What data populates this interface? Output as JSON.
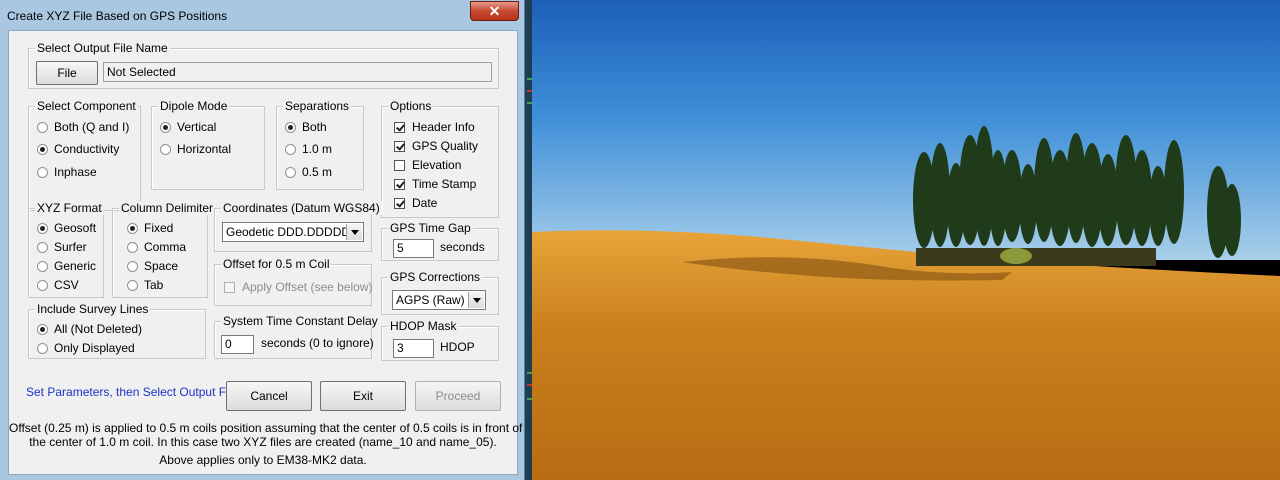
{
  "window": {
    "title": "Create XYZ File Based on GPS Positions",
    "close_glyph": "✕"
  },
  "output_file": {
    "group_label": "Select Output File Name",
    "button_label": "File",
    "path_value": "Not Selected"
  },
  "component": {
    "label": "Select Component",
    "options": [
      "Both (Q and I)",
      "Conductivity",
      "Inphase"
    ],
    "selected": "Conductivity"
  },
  "dipole": {
    "label": "Dipole Mode",
    "options": [
      "Vertical",
      "Horizontal"
    ],
    "selected": "Vertical"
  },
  "separations": {
    "label": "Separations",
    "options": [
      "Both",
      "1.0 m",
      "0.5 m"
    ],
    "selected": "Both"
  },
  "options": {
    "label": "Options",
    "items": [
      {
        "label": "Header Info",
        "checked": true
      },
      {
        "label": "GPS Quality",
        "checked": true
      },
      {
        "label": "Elevation",
        "checked": false
      },
      {
        "label": "Time Stamp",
        "checked": true
      },
      {
        "label": "Date",
        "checked": true
      }
    ]
  },
  "xyz_format": {
    "label": "XYZ Format",
    "options": [
      "Geosoft",
      "Surfer",
      "Generic",
      "CSV"
    ],
    "selected": "Geosoft"
  },
  "column_delimiter": {
    "label": "Column Delimiter",
    "options": [
      "Fixed",
      "Comma",
      "Space",
      "Tab"
    ],
    "selected": "Fixed"
  },
  "coordinates": {
    "label": "Coordinates (Datum WGS84)",
    "value": "Geodetic DDD.DDDDD"
  },
  "offset": {
    "label": "Offset for 0.5 m Coil",
    "checkbox_label": "Apply Offset (see below)",
    "checked": false
  },
  "time_constant": {
    "label": "System Time Constant Delay",
    "value": "0",
    "suffix": "seconds (0 to ignore)"
  },
  "gps_time_gap": {
    "label": "GPS Time Gap",
    "value": "5",
    "suffix": "seconds"
  },
  "gps_corrections": {
    "label": "GPS Corrections",
    "value": "AGPS (Raw)"
  },
  "hdop": {
    "label": "HDOP Mask",
    "value": "3",
    "suffix": "HDOP"
  },
  "survey_lines": {
    "label": "Include Survey Lines",
    "options": [
      "All  (Not Deleted)",
      "Only Displayed"
    ],
    "selected": "All  (Not Deleted)"
  },
  "status_text": "Set Parameters, then Select Output File",
  "buttons": {
    "cancel": "Cancel",
    "exit": "Exit",
    "proceed": "Proceed"
  },
  "notes": [
    "Offset (0.25 m) is applied to 0.5 m coils position assuming that the center of 0.5 coils is in front of",
    "the center of 1.0 m coil. In this case two XYZ files are created (name_10 and name_05).",
    "Above applies only to EM38-MK2 data."
  ],
  "colors": {
    "status_text": "#1a32c8",
    "titlebar": "#aac7e2",
    "close_button": "#c64a32",
    "sky": "#1f6cc0",
    "field": "#d08a22"
  }
}
